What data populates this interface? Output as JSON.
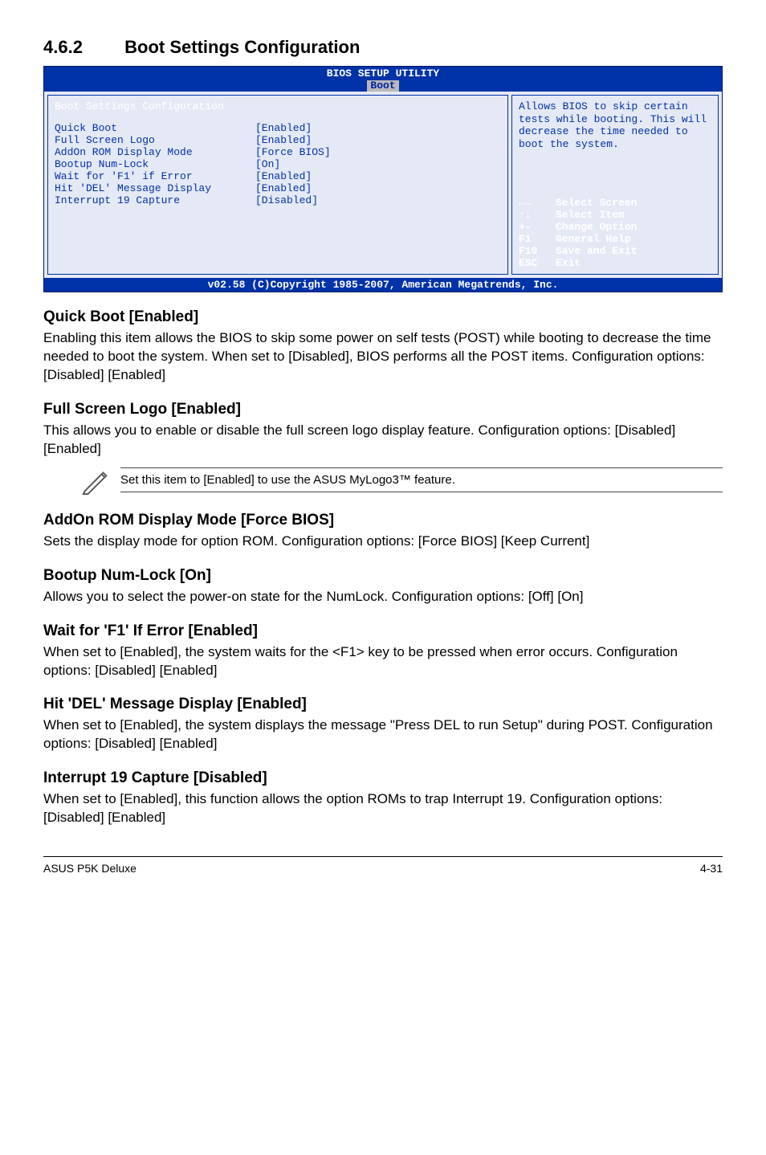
{
  "section": {
    "number": "4.6.2",
    "title": "Boot Settings Configuration"
  },
  "bios": {
    "title": "BIOS SETUP UTILITY",
    "tab": "Boot",
    "panel_heading": "Boot Settings Configuration",
    "items": [
      {
        "label": "Quick Boot",
        "value": "[Enabled]"
      },
      {
        "label": "Full Screen Logo",
        "value": "[Enabled]"
      },
      {
        "label": "AddOn ROM Display Mode",
        "value": "[Force BIOS]"
      },
      {
        "label": "Bootup Num-Lock",
        "value": "[On]"
      },
      {
        "label": "Wait for 'F1' if Error",
        "value": "[Enabled]"
      },
      {
        "label": "Hit 'DEL' Message Display",
        "value": "[Enabled]"
      },
      {
        "label": "Interrupt 19 Capture",
        "value": "[Disabled]"
      }
    ],
    "help": "Allows BIOS to skip certain tests while booting. This will decrease the time needed to boot the system.",
    "keys": [
      {
        "sym": "←→",
        "text": "Select Screen"
      },
      {
        "sym": "↑↓",
        "text": "Select Item"
      },
      {
        "sym": "+-",
        "text": "Change Option"
      },
      {
        "sym": "F1",
        "text": "General Help"
      },
      {
        "sym": "F10",
        "text": "Save and Exit"
      },
      {
        "sym": "ESC",
        "text": "Exit"
      }
    ],
    "footer": "v02.58 (C)Copyright 1985-2007, American Megatrends, Inc."
  },
  "sections": {
    "quick_boot": {
      "heading": "Quick Boot [Enabled]",
      "body": "Enabling this item allows the BIOS to skip some power on self tests (POST) while booting to decrease the time needed to boot the system. When set to [Disabled], BIOS performs all the POST items. Configuration options: [Disabled] [Enabled]"
    },
    "full_screen_logo": {
      "heading": "Full Screen Logo [Enabled]",
      "body": "This allows you to enable or disable the full screen logo display feature. Configuration options: [Disabled] [Enabled]"
    },
    "note": "Set this item to [Enabled] to use the ASUS MyLogo3™ feature.",
    "addon_rom": {
      "heading": "AddOn ROM Display Mode [Force BIOS]",
      "body": "Sets the display mode for option ROM. Configuration options: [Force BIOS] [Keep Current]"
    },
    "bootup_numlock": {
      "heading": "Bootup Num-Lock [On]",
      "body": "Allows you to select the power-on state for the NumLock. Configuration options: [Off] [On]"
    },
    "wait_f1": {
      "heading": "Wait for 'F1' If Error [Enabled]",
      "body": "When set to [Enabled], the system waits for the <F1> key to be pressed when error occurs. Configuration options: [Disabled] [Enabled]"
    },
    "hit_del": {
      "heading": "Hit 'DEL' Message Display [Enabled]",
      "body": "When set to [Enabled], the system displays the message \"Press DEL to run Setup\" during POST. Configuration options: [Disabled] [Enabled]"
    },
    "interrupt19": {
      "heading": "Interrupt 19 Capture [Disabled]",
      "body": "When set to [Enabled], this function allows the option ROMs to trap Interrupt 19. Configuration options: [Disabled] [Enabled]"
    }
  },
  "footer": {
    "left": "ASUS P5K Deluxe",
    "right": "4-31"
  }
}
